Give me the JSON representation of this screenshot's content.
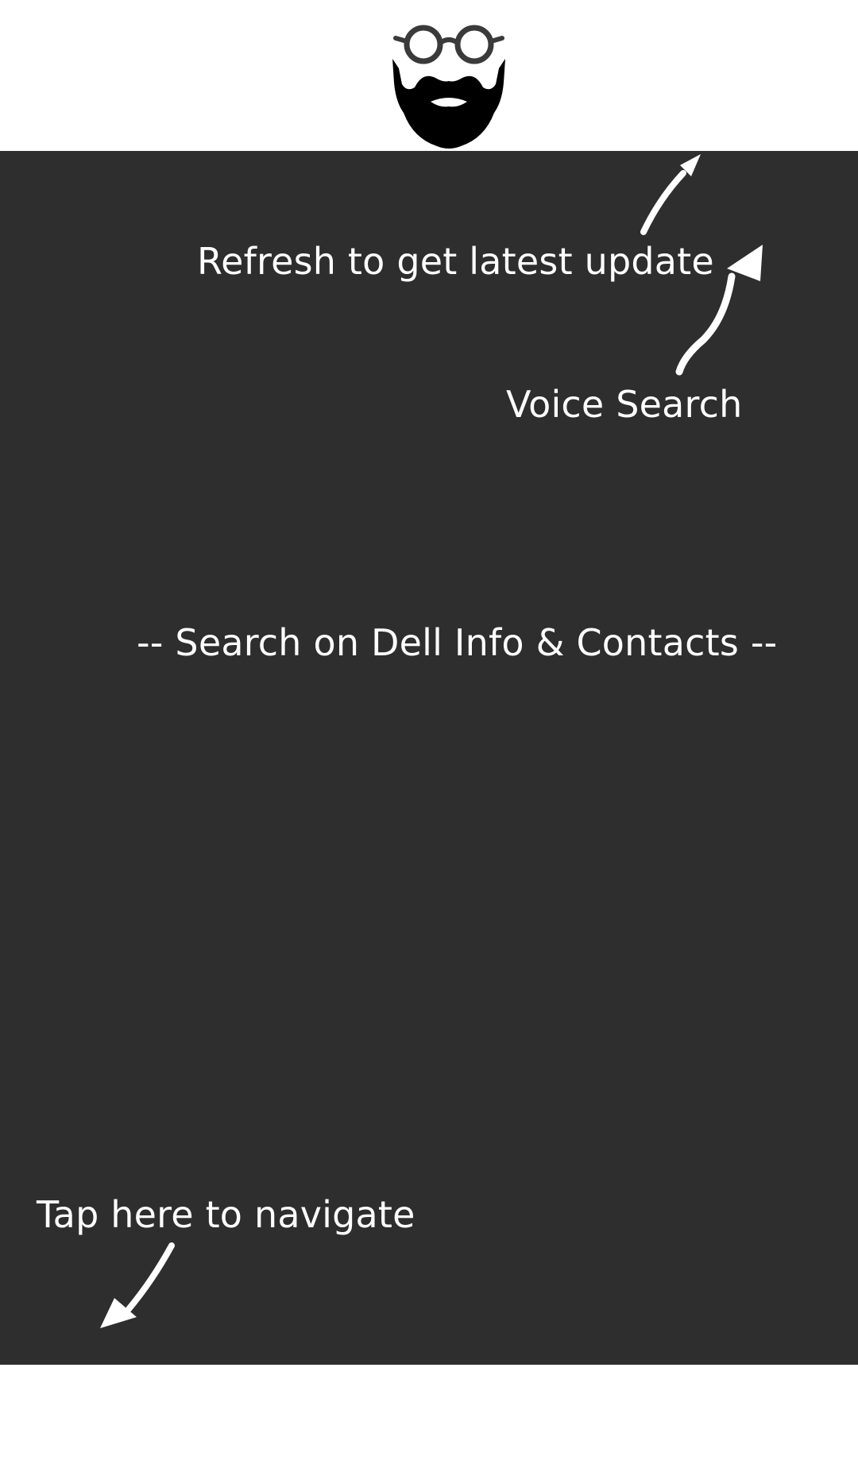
{
  "hints": {
    "refresh": "Refresh to get latest update",
    "voice_search": "Voice Search",
    "search_placeholder": "-- Search on Dell Info & Contacts --",
    "navigate": "Tap here to navigate"
  },
  "icons": {
    "logo": "bearded-man-glasses-icon",
    "refresh_arrow": "arrow-up-right-icon",
    "voice_arrow": "arrow-up-right-icon",
    "navigate_arrow": "arrow-down-left-icon"
  },
  "colors": {
    "overlay": "#2e2e2e",
    "text": "#ffffff",
    "logo_beard": "#000000",
    "logo_glasses": "#3a3a3a"
  }
}
